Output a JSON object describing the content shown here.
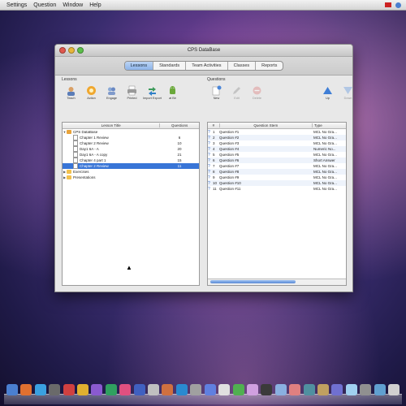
{
  "menubar": {
    "items": [
      "Settings",
      "Question",
      "Window",
      "Help"
    ]
  },
  "window": {
    "title": "CPS DataBase",
    "tabs": [
      "Lessons",
      "Standards",
      "Team Activities",
      "Classes",
      "Reports"
    ],
    "active_tab": "Lessons"
  },
  "lessons": {
    "label": "Lessons",
    "tools": [
      {
        "label": "Teach",
        "icon": "teach-icon"
      },
      {
        "label": "Action",
        "icon": "action-icon"
      },
      {
        "label": "Engage",
        "icon": "engage-icon"
      },
      {
        "label": "Printed",
        "icon": "print-icon"
      },
      {
        "label": "Import Export",
        "icon": "import-export-icon"
      },
      {
        "label": "at Bir",
        "icon": "android-icon"
      }
    ],
    "columns": [
      "Lesson Title",
      "Questions"
    ],
    "tree": [
      {
        "title": "CPS DataBase",
        "count": "",
        "level": 0,
        "type": "db",
        "expanded": true
      },
      {
        "title": "Chapter 1 Review",
        "count": "6",
        "level": 1,
        "type": "doc"
      },
      {
        "title": "Chapter 2 Review",
        "count": "10",
        "level": 1,
        "type": "doc"
      },
      {
        "title": "Day1 6A - A",
        "count": "20",
        "level": 1,
        "type": "doc"
      },
      {
        "title": "Day1 6A - A copy",
        "count": "21",
        "level": 1,
        "type": "doc"
      },
      {
        "title": "Chapter 4 part 1",
        "count": "15",
        "level": 1,
        "type": "doc"
      },
      {
        "title": "Chapter 2 Review",
        "count": "11",
        "level": 1,
        "type": "doc",
        "selected": true
      },
      {
        "title": "Exercises",
        "count": "",
        "level": 0,
        "type": "folder"
      },
      {
        "title": "Presentations",
        "count": "",
        "level": 0,
        "type": "folder"
      }
    ]
  },
  "questions": {
    "label": "Questions",
    "tools": [
      {
        "label": "New",
        "icon": "new-question-icon"
      },
      {
        "label": "Edit",
        "icon": "edit-icon"
      },
      {
        "label": "Delete",
        "icon": "delete-icon"
      },
      {
        "label": "Up",
        "icon": "up-arrow-icon"
      },
      {
        "label": "Down",
        "icon": "down-arrow-icon"
      }
    ],
    "columns": [
      "#",
      "Question Stem",
      "Type"
    ],
    "rows": [
      {
        "num": "1",
        "stem": "Question #1",
        "type": "MCL No Gra..."
      },
      {
        "num": "2",
        "stem": "Question #2",
        "type": "MCL No Gra..."
      },
      {
        "num": "3",
        "stem": "Question #3",
        "type": "MCL No Gra..."
      },
      {
        "num": "4",
        "stem": "Question #4",
        "type": "Numeric No..."
      },
      {
        "num": "5",
        "stem": "Question #5",
        "type": "MCL No Gra..."
      },
      {
        "num": "6",
        "stem": "Question #6",
        "type": "Short Answer"
      },
      {
        "num": "7",
        "stem": "Question #7",
        "type": "MCL No Gra..."
      },
      {
        "num": "8",
        "stem": "Question #8",
        "type": "MCL No Gra..."
      },
      {
        "num": "9",
        "stem": "Question #9",
        "type": "MCL No Gra..."
      },
      {
        "num": "10",
        "stem": "Question #10",
        "type": "MCL No Gra..."
      },
      {
        "num": "11",
        "stem": "Question #11",
        "type": "MCL No Gra..."
      }
    ]
  },
  "colors": {
    "selection": "#3875d7",
    "tab_active": "#8db4ea"
  }
}
